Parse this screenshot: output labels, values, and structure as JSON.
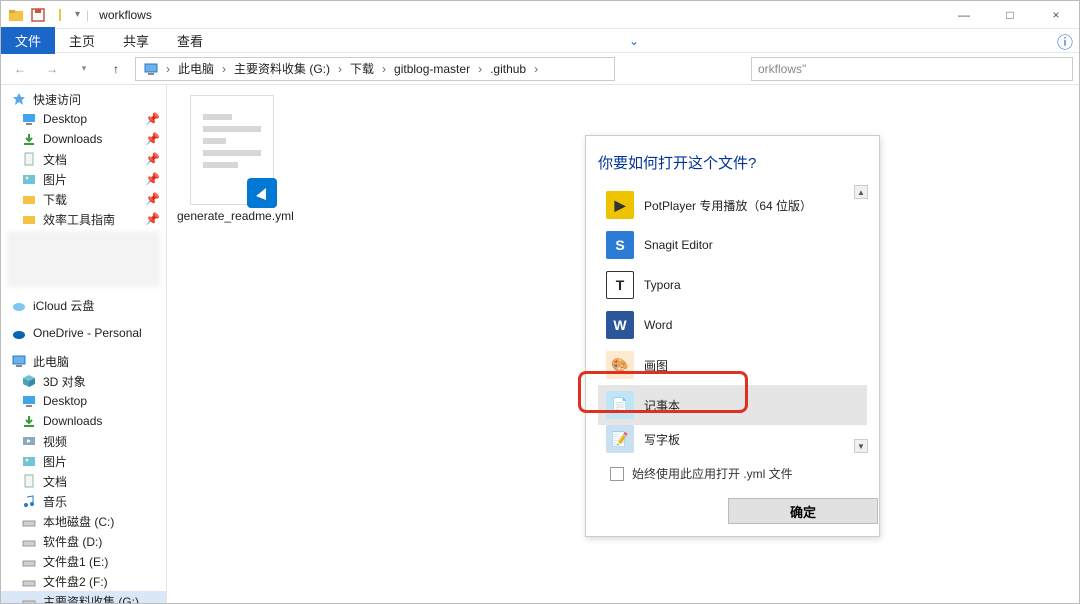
{
  "window": {
    "title": "workflows",
    "min": "—",
    "max": "□",
    "close": "×"
  },
  "menubar": {
    "file": "文件",
    "home": "主页",
    "share": "共享",
    "view": "查看"
  },
  "breadcrumbs": [
    "此电脑",
    "主要资料收集 (G:)",
    "下载",
    "gitblog-master",
    ".github"
  ],
  "search": {
    "placeholder": "orkflows\""
  },
  "sidebar": {
    "quickaccess": {
      "label": "快速访问",
      "items": [
        {
          "label": "Desktop",
          "icon": "desktop"
        },
        {
          "label": "Downloads",
          "icon": "downloads"
        },
        {
          "label": "文档",
          "icon": "documents"
        },
        {
          "label": "图片",
          "icon": "pictures"
        },
        {
          "label": "下载",
          "icon": "folder"
        },
        {
          "label": "效率工具指南",
          "icon": "folder"
        }
      ]
    },
    "clouds": [
      {
        "label": "iCloud 云盘",
        "icon": "icloud"
      },
      {
        "label": "OneDrive - Personal",
        "icon": "onedrive"
      }
    ],
    "thispc": {
      "label": "此电脑",
      "items": [
        {
          "label": "3D 对象",
          "icon": "3d"
        },
        {
          "label": "Desktop",
          "icon": "desktop"
        },
        {
          "label": "Downloads",
          "icon": "downloads"
        },
        {
          "label": "视频",
          "icon": "videos"
        },
        {
          "label": "图片",
          "icon": "pictures"
        },
        {
          "label": "文档",
          "icon": "documents"
        },
        {
          "label": "音乐",
          "icon": "music"
        },
        {
          "label": "本地磁盘 (C:)",
          "icon": "drive"
        },
        {
          "label": "软件盘 (D:)",
          "icon": "drive"
        },
        {
          "label": "文件盘1 (E:)",
          "icon": "drive"
        },
        {
          "label": "文件盘2 (F:)",
          "icon": "drive"
        },
        {
          "label": "主要资料收集 (G:)",
          "icon": "drive",
          "selected": true
        }
      ]
    }
  },
  "file": {
    "name": "generate_readme.yml"
  },
  "dialog": {
    "title": "你要如何打开这个文件?",
    "apps": [
      {
        "label": "PotPlayer 专用播放（64 位版）",
        "color": "#f0c300",
        "iconText": "▶"
      },
      {
        "label": "Snagit Editor",
        "color": "#2c7bd4",
        "iconText": "S"
      },
      {
        "label": "Typora",
        "color": "#ffffff",
        "iconText": "T",
        "border": true
      },
      {
        "label": "Word",
        "color": "#2b579a",
        "iconText": "W"
      },
      {
        "label": "画图",
        "color": "#ffe9cf",
        "iconText": "🎨"
      },
      {
        "label": "记事本",
        "color": "#bfe5f6",
        "iconText": "📄",
        "selected": true
      },
      {
        "label": "写字板",
        "color": "#c8e0ef",
        "iconText": "📝"
      }
    ],
    "always": "始终使用此应用打开 .yml 文件",
    "ok": "确定"
  }
}
